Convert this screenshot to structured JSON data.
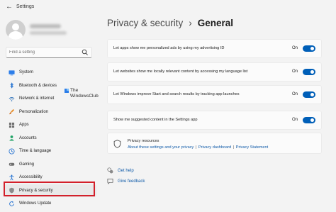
{
  "window": {
    "title": "Settings"
  },
  "sidebar": {
    "search_placeholder": "Find a setting",
    "items": [
      {
        "label": "System",
        "icon": "monitor-icon"
      },
      {
        "label": "Bluetooth & devices",
        "icon": "bluetooth-icon"
      },
      {
        "label": "Network & internet",
        "icon": "wifi-icon"
      },
      {
        "label": "Personalization",
        "icon": "brush-icon"
      },
      {
        "label": "Apps",
        "icon": "apps-icon"
      },
      {
        "label": "Accounts",
        "icon": "person-icon"
      },
      {
        "label": "Time & language",
        "icon": "globe-clock-icon"
      },
      {
        "label": "Gaming",
        "icon": "gamepad-icon"
      },
      {
        "label": "Accessibility",
        "icon": "accessibility-icon"
      },
      {
        "label": "Privacy & security",
        "icon": "shield-icon",
        "selected": true
      },
      {
        "label": "Windows Update",
        "icon": "update-icon"
      }
    ]
  },
  "watermark": {
    "line1": "The",
    "line2": "WindowsClub"
  },
  "header": {
    "parent": "Privacy & security",
    "separator": "›",
    "current": "General"
  },
  "settings": [
    {
      "label": "Let apps show me personalized ads by using my advertising ID",
      "state": "On",
      "on": true
    },
    {
      "label": "Let websites show me locally relevant content by accessing my language list",
      "state": "On",
      "on": true
    },
    {
      "label": "Let Windows improve Start and search results by tracking app launches",
      "state": "On",
      "on": true
    },
    {
      "label": "Show me suggested content in the Settings app",
      "state": "On",
      "on": true
    }
  ],
  "resources": {
    "title": "Privacy resources",
    "links": [
      "About these settings and your privacy",
      "Privacy dashboard",
      "Privacy Statement"
    ],
    "separator": "|"
  },
  "help": {
    "get_help": "Get help",
    "give_feedback": "Give feedback"
  },
  "colors": {
    "accent": "#005fb8",
    "link": "#0f5aa8",
    "highlight": "#d3202b",
    "background": "#f3f3f3",
    "card": "#fbfbfb"
  }
}
